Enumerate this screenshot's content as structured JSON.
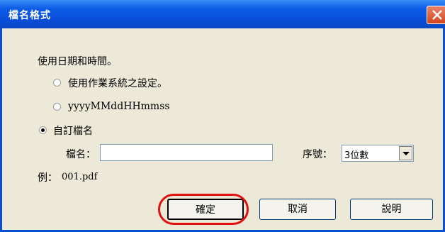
{
  "window": {
    "title": "檔名格式"
  },
  "options": {
    "use_date_label": "使用日期和時間。",
    "radio_system": "使用作業系統之設定。",
    "radio_format": "yyyyMMddHHmmss",
    "radio_custom": "自訂檔名",
    "selected": "custom"
  },
  "custom": {
    "filename_label": "檔名：",
    "filename_value": "",
    "sequence_label": "序號：",
    "sequence_value": "3位數"
  },
  "example": {
    "label": "例：",
    "value": "001.pdf"
  },
  "buttons": {
    "ok": "確定",
    "cancel": "取消",
    "help": "說明"
  },
  "colors": {
    "titlebar": "#0a4ed8",
    "highlight": "#e01010",
    "background": "#ece9d8"
  }
}
